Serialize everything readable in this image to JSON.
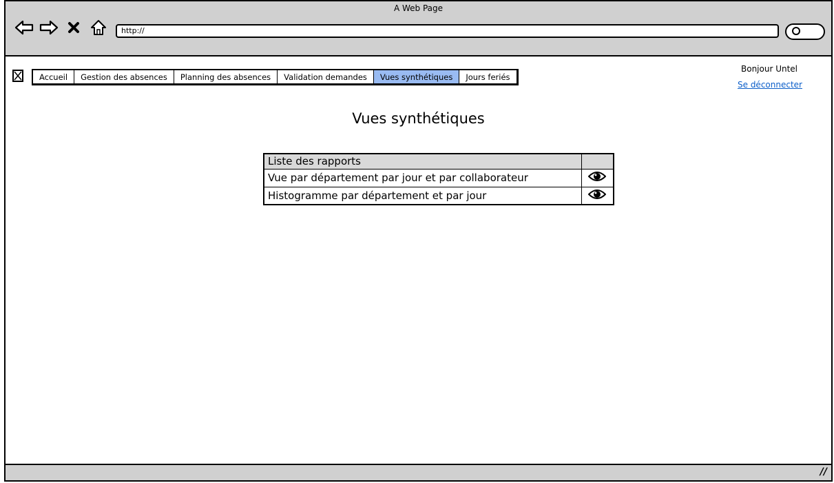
{
  "window": {
    "title": "A Web Page"
  },
  "browser": {
    "address": "http://",
    "icons": [
      "back-arrow-icon",
      "forward-arrow-icon",
      "close-x-icon",
      "home-icon",
      "search-icon"
    ]
  },
  "tabs": [
    {
      "label": "Accueil",
      "active": false
    },
    {
      "label": "Gestion des absences",
      "active": false
    },
    {
      "label": "Planning des absences",
      "active": false
    },
    {
      "label": "Validation demandes",
      "active": false
    },
    {
      "label": "Vues synthétiques",
      "active": true
    },
    {
      "label": "Jours feriés",
      "active": false
    }
  ],
  "user": {
    "greeting": "Bonjour Untel",
    "logout": "Se déconnecter"
  },
  "page": {
    "title": "Vues synthétiques"
  },
  "reports_table": {
    "header": "Liste des rapports",
    "rows": [
      {
        "name": "Vue par département par jour et par collaborateur",
        "action_icon": "eye-icon"
      },
      {
        "name": "Histogramme par département et par jour",
        "action_icon": "eye-icon"
      }
    ]
  },
  "colors": {
    "chrome": "#d0d0d0",
    "active_tab": "#99bbf2",
    "link": "#0b5ec9"
  }
}
